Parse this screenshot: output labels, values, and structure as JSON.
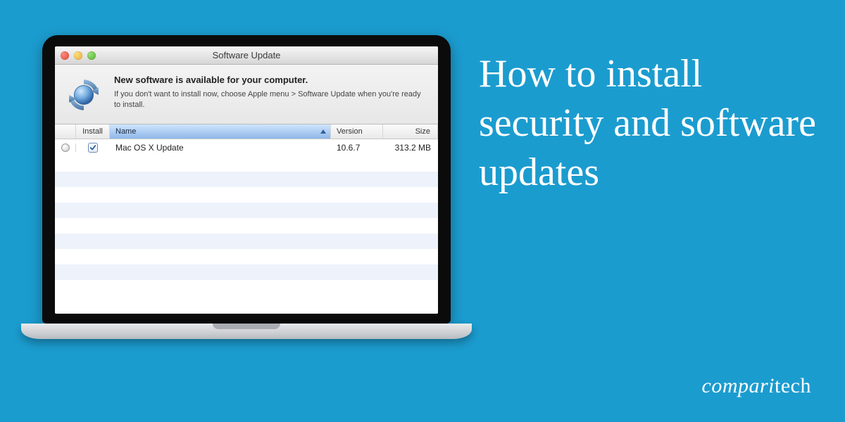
{
  "headline": "How to install security and software updates",
  "brand_light": "compari",
  "brand_bold": "tech",
  "window": {
    "title": "Software Update",
    "heading": "New software is available for your computer.",
    "subtext": "If you don't want to install now, choose Apple menu > Software Update when you're ready to install."
  },
  "columns": {
    "install": "Install",
    "name": "Name",
    "version": "Version",
    "size": "Size"
  },
  "row": {
    "name": "Mac OS X Update",
    "version": "10.6.7",
    "size": "313.2 MB",
    "checked": true
  }
}
